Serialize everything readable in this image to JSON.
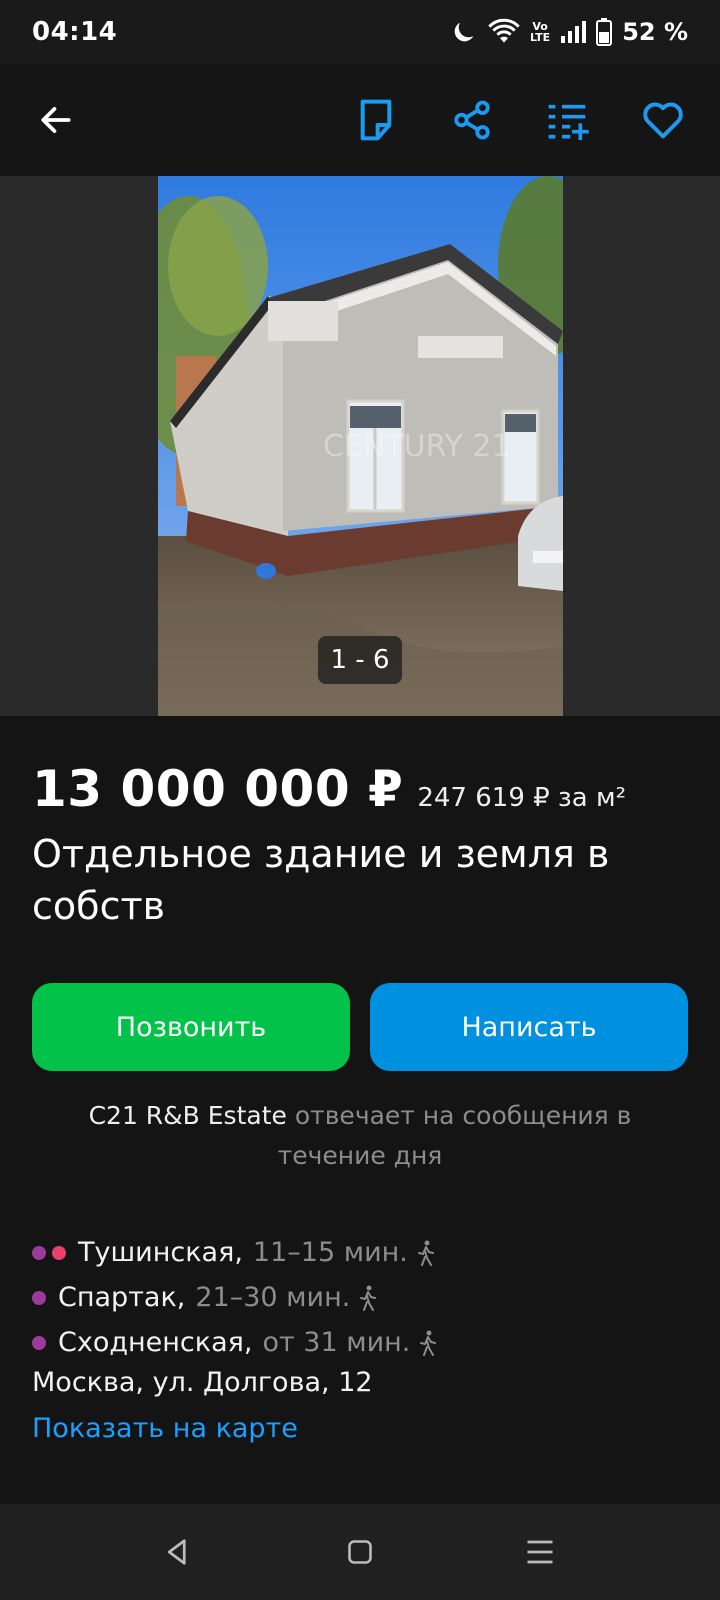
{
  "status_bar": {
    "time": "04:14",
    "volte_top": "Vo",
    "volte_bottom": "LTE",
    "battery": "52 %"
  },
  "toolbar": {
    "icons": [
      "arrow-left-icon",
      "note-icon",
      "share-icon",
      "compare-list-icon",
      "heart-icon"
    ],
    "accent_color": "#1a9bf0"
  },
  "gallery": {
    "counter": "1 - 6",
    "watermark": "CENTURY 21"
  },
  "listing": {
    "price": "13 000 000 ₽",
    "price_per_m2": "247 619 ₽ за м²",
    "title": "Отдельное здание и земля в собств"
  },
  "actions": {
    "call_label": "Позвонить",
    "call_color": "#03c24a",
    "write_label": "Написать",
    "write_color": "#0090e0"
  },
  "seller": {
    "name": "C21 R&B Estate",
    "response_text": "отвечает на сообщения в течение дня"
  },
  "location": {
    "metro": [
      {
        "name": "Тушинская,",
        "time": "11–15 мин.",
        "line_colors": [
          "#9b3a9b",
          "#e8416e"
        ]
      },
      {
        "name": "Спартак,",
        "time": "21–30 мин.",
        "line_colors": [
          "#9b3a9b"
        ]
      },
      {
        "name": "Сходненская,",
        "time": "от 31 мин.",
        "line_colors": [
          "#9b3a9b"
        ]
      }
    ],
    "address": "Москва, ул. Долгова, 12",
    "map_link": "Показать на карте"
  },
  "nav_bar": {
    "icons": [
      "back-triangle-icon",
      "home-square-icon",
      "menu-lines-icon"
    ]
  }
}
